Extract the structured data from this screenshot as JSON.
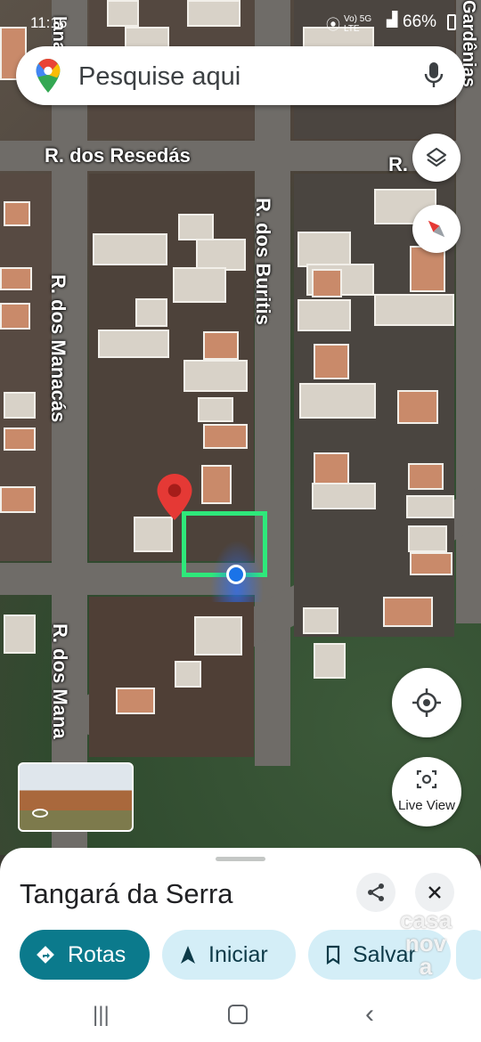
{
  "status_bar": {
    "time": "11:16",
    "network_labels": "Vo) 5G LTE",
    "battery": "66%"
  },
  "search": {
    "placeholder": "Pesquise aqui"
  },
  "map": {
    "streets": [
      "R. dos Resedás",
      "R. dos Buritis",
      "R. dos Manacás",
      "R. dos Mana",
      "R.",
      "Gardênias",
      "lana"
    ],
    "pin_icon": "red-location-pin",
    "selection_color": "#2ee87a"
  },
  "buttons": {
    "layers_icon": "layers-icon",
    "compass_icon": "compass-icon",
    "location_icon": "my-location-icon",
    "live_view_label": "Live View"
  },
  "place": {
    "name": "Tangará da Serra"
  },
  "actions": [
    {
      "label": "Rotas",
      "icon": "directions-icon"
    },
    {
      "label": "Iniciar",
      "icon": "navigation-arrow-icon"
    },
    {
      "label": "Salvar",
      "icon": "bookmark-icon"
    }
  ],
  "watermark": {
    "text": "casa nova"
  },
  "colors": {
    "accent": "#0b7a8c",
    "chip_bg": "#d4eef7",
    "pin": "#e53935"
  }
}
